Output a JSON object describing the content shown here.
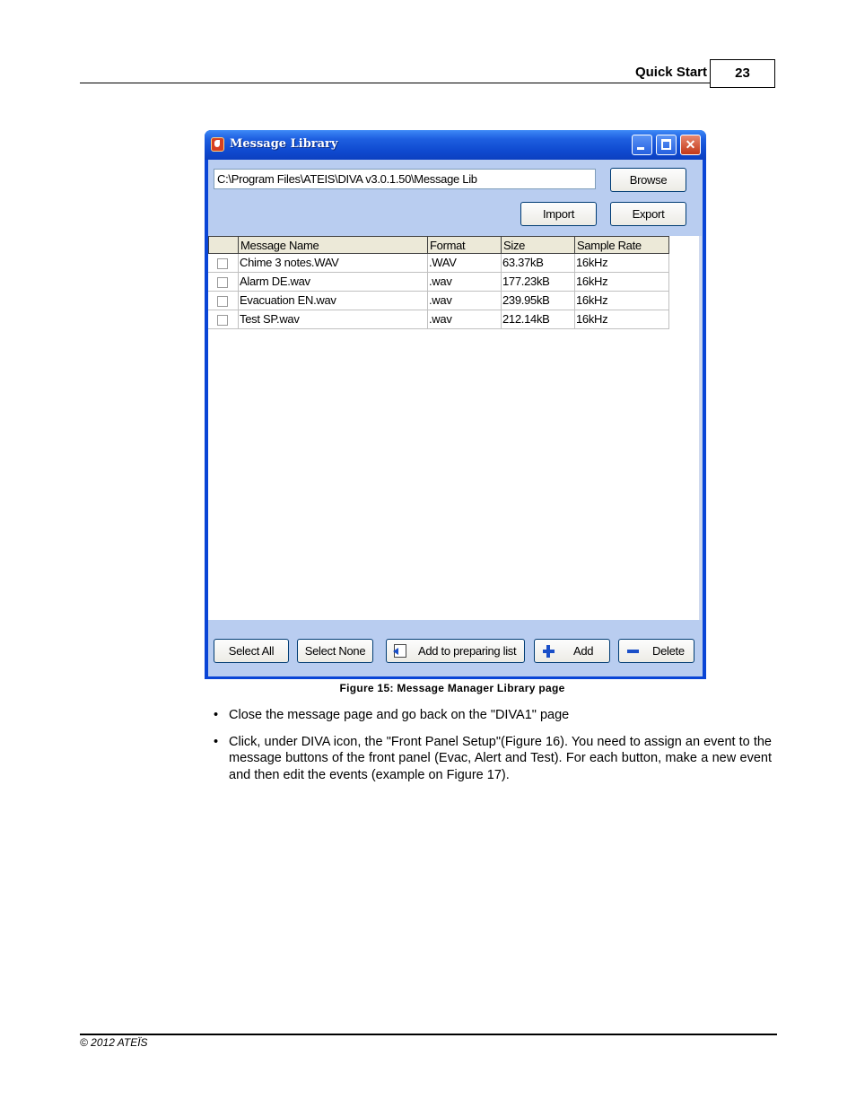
{
  "header": {
    "section": "Quick Start",
    "page_number": "23"
  },
  "window": {
    "title": "Message Library",
    "path_value": "C:\\Program Files\\ATEIS\\DIVA v3.0.1.50\\Message Lib",
    "browse_label": "Browse",
    "import_label": "Import",
    "export_label": "Export",
    "columns": [
      "Message Name",
      "Format",
      "Size",
      "Sample Rate"
    ],
    "rows": [
      {
        "name": "Chime 3 notes.WAV",
        "format": ".WAV",
        "size": "63.37kB",
        "rate": "16kHz"
      },
      {
        "name": "Alarm DE.wav",
        "format": ".wav",
        "size": "177.23kB",
        "rate": "16kHz"
      },
      {
        "name": "Evacuation EN.wav",
        "format": ".wav",
        "size": "239.95kB",
        "rate": "16kHz"
      },
      {
        "name": "Test SP.wav",
        "format": ".wav",
        "size": "212.14kB",
        "rate": "16kHz"
      }
    ],
    "select_all_label": "Select All",
    "select_none_label": "Select None",
    "add_preparing_label": "Add to preparing list",
    "add_label": "Add",
    "delete_label": "Delete"
  },
  "caption": "Figure 15: Message Manager Library page",
  "bullets": [
    "Close the message page and go back on the \"DIVA1\" page",
    "Click, under DIVA icon, the \"Front Panel Setup\"(Figure 16). You need to assign an event to the message buttons of the front panel (Evac, Alert and Test). For each button, make a new event and then edit the events (example on Figure 17)."
  ],
  "bullet_symbol": "•",
  "footer": "© 2012 ATEÏS"
}
